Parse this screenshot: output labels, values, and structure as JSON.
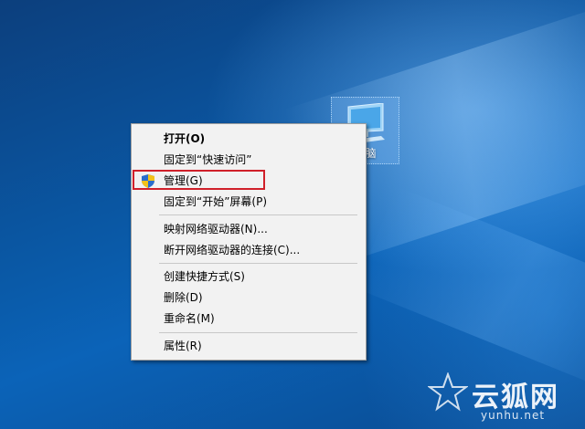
{
  "desktop": {
    "icon_label": "电脑",
    "icon_name": "computer-icon"
  },
  "context_menu": {
    "items": [
      {
        "label": "打开(O)",
        "bold": true
      },
      {
        "label": "固定到“快速访问”"
      },
      {
        "label": "管理(G)",
        "icon": "shield-icon",
        "highlighted": true,
        "highlight_color": "#d0202a"
      },
      {
        "label": "固定到“开始”屏幕(P)"
      },
      {
        "label": "映射网络驱动器(N)..."
      },
      {
        "label": "断开网络驱动器的连接(C)..."
      },
      {
        "label": "创建快捷方式(S)"
      },
      {
        "label": "删除(D)"
      },
      {
        "label": "重命名(M)"
      },
      {
        "label": "属性(R)"
      }
    ]
  },
  "watermark": {
    "text": "云狐网",
    "url": "yunhu.net"
  }
}
